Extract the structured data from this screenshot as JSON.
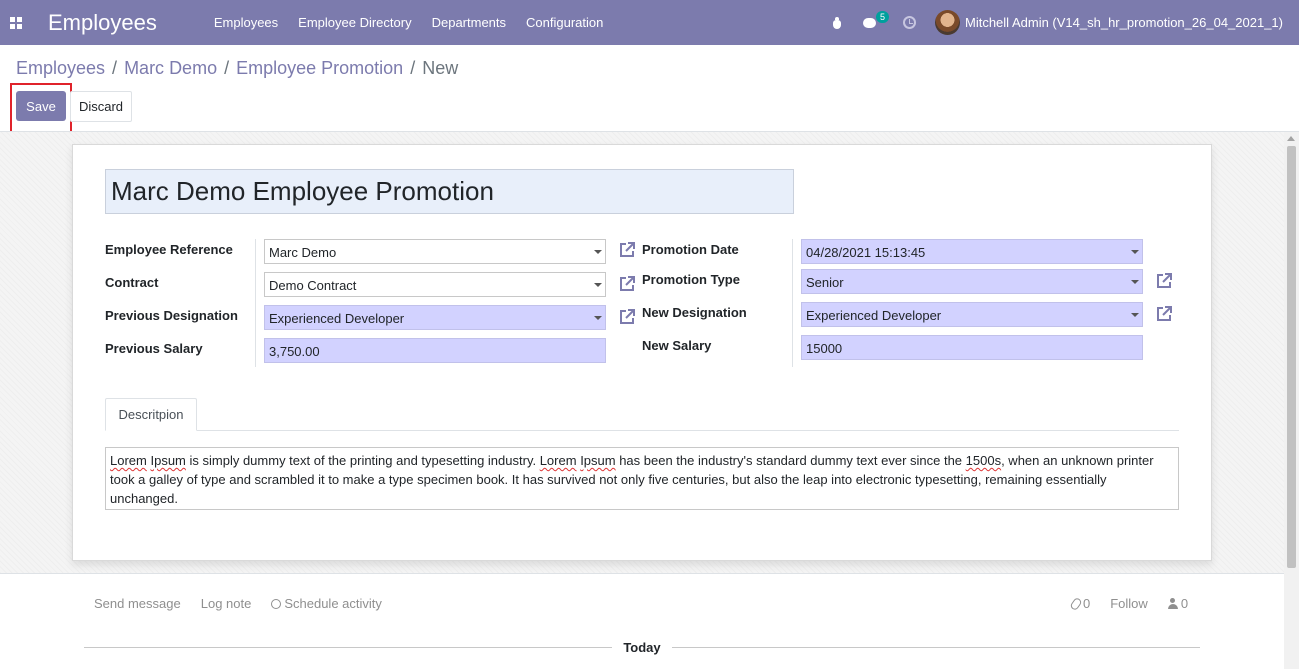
{
  "navbar": {
    "app_title": "Employees",
    "menu": [
      "Employees",
      "Employee Directory",
      "Departments",
      "Configuration"
    ],
    "chat_badge": "5",
    "user": "Mitchell Admin (V14_sh_hr_promotion_26_04_2021_1)"
  },
  "breadcrumb": {
    "items": [
      "Employees",
      "Marc Demo",
      "Employee Promotion"
    ],
    "current": "New",
    "sep": "/"
  },
  "buttons": {
    "save": "Save",
    "discard": "Discard"
  },
  "form": {
    "title": "Marc Demo Employee Promotion",
    "labels": {
      "employee_reference": "Employee Reference",
      "contract": "Contract",
      "previous_designation": "Previous Designation",
      "previous_salary": "Previous Salary",
      "promotion_date": "Promotion Date",
      "promotion_type": "Promotion Type",
      "new_designation": "New Designation",
      "new_salary": "New Salary"
    },
    "values": {
      "employee_reference": "Marc Demo",
      "contract": "Demo Contract",
      "previous_designation": "Experienced Developer",
      "previous_salary": "3,750.00",
      "promotion_date": "04/28/2021 15:13:45",
      "promotion_type": "Senior",
      "new_designation": "Experienced Developer",
      "new_salary": "15000"
    },
    "tab": "Descritpion",
    "description": {
      "w1": "Lorem",
      "w2": "Ipsum",
      "t1": " is simply dummy text of the printing and typesetting industry. ",
      "w3": "Lorem",
      "w4": "Ipsum",
      "t2": " has been the industry's standard dummy text ever since the ",
      "w5": "1500s",
      "t3": ", when an unknown printer took a galley of type and scrambled it to make a type specimen book. It has survived not only five centuries, but also the leap into electronic typesetting, remaining essentially unchanged."
    }
  },
  "chatter": {
    "send_message": "Send message",
    "log_note": "Log note",
    "schedule_activity": "Schedule activity",
    "attachments": "0",
    "follow": "Follow",
    "followers": "0",
    "today": "Today"
  },
  "colors": {
    "brand": "#7C7BAD",
    "required_field": "#D2D2FF",
    "highlight": "#E0232B"
  }
}
